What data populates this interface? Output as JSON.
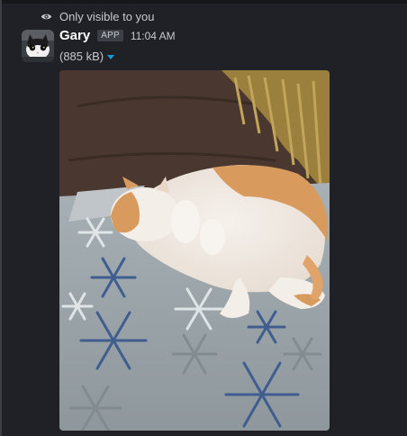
{
  "message": {
    "visibility_text": "Only visible to you",
    "sender_name": "Gary",
    "badge": "APP",
    "timestamp": "11:04 AM",
    "file_size": "(885 kB)"
  },
  "icons": {
    "visibility": "eye-icon",
    "file_menu": "caret-down-icon"
  },
  "colors": {
    "background": "#1f2126",
    "text_primary": "#ffffff",
    "text_secondary": "#c7c9cc",
    "badge_bg": "#3c4046",
    "caret": "#1d9bd1"
  }
}
